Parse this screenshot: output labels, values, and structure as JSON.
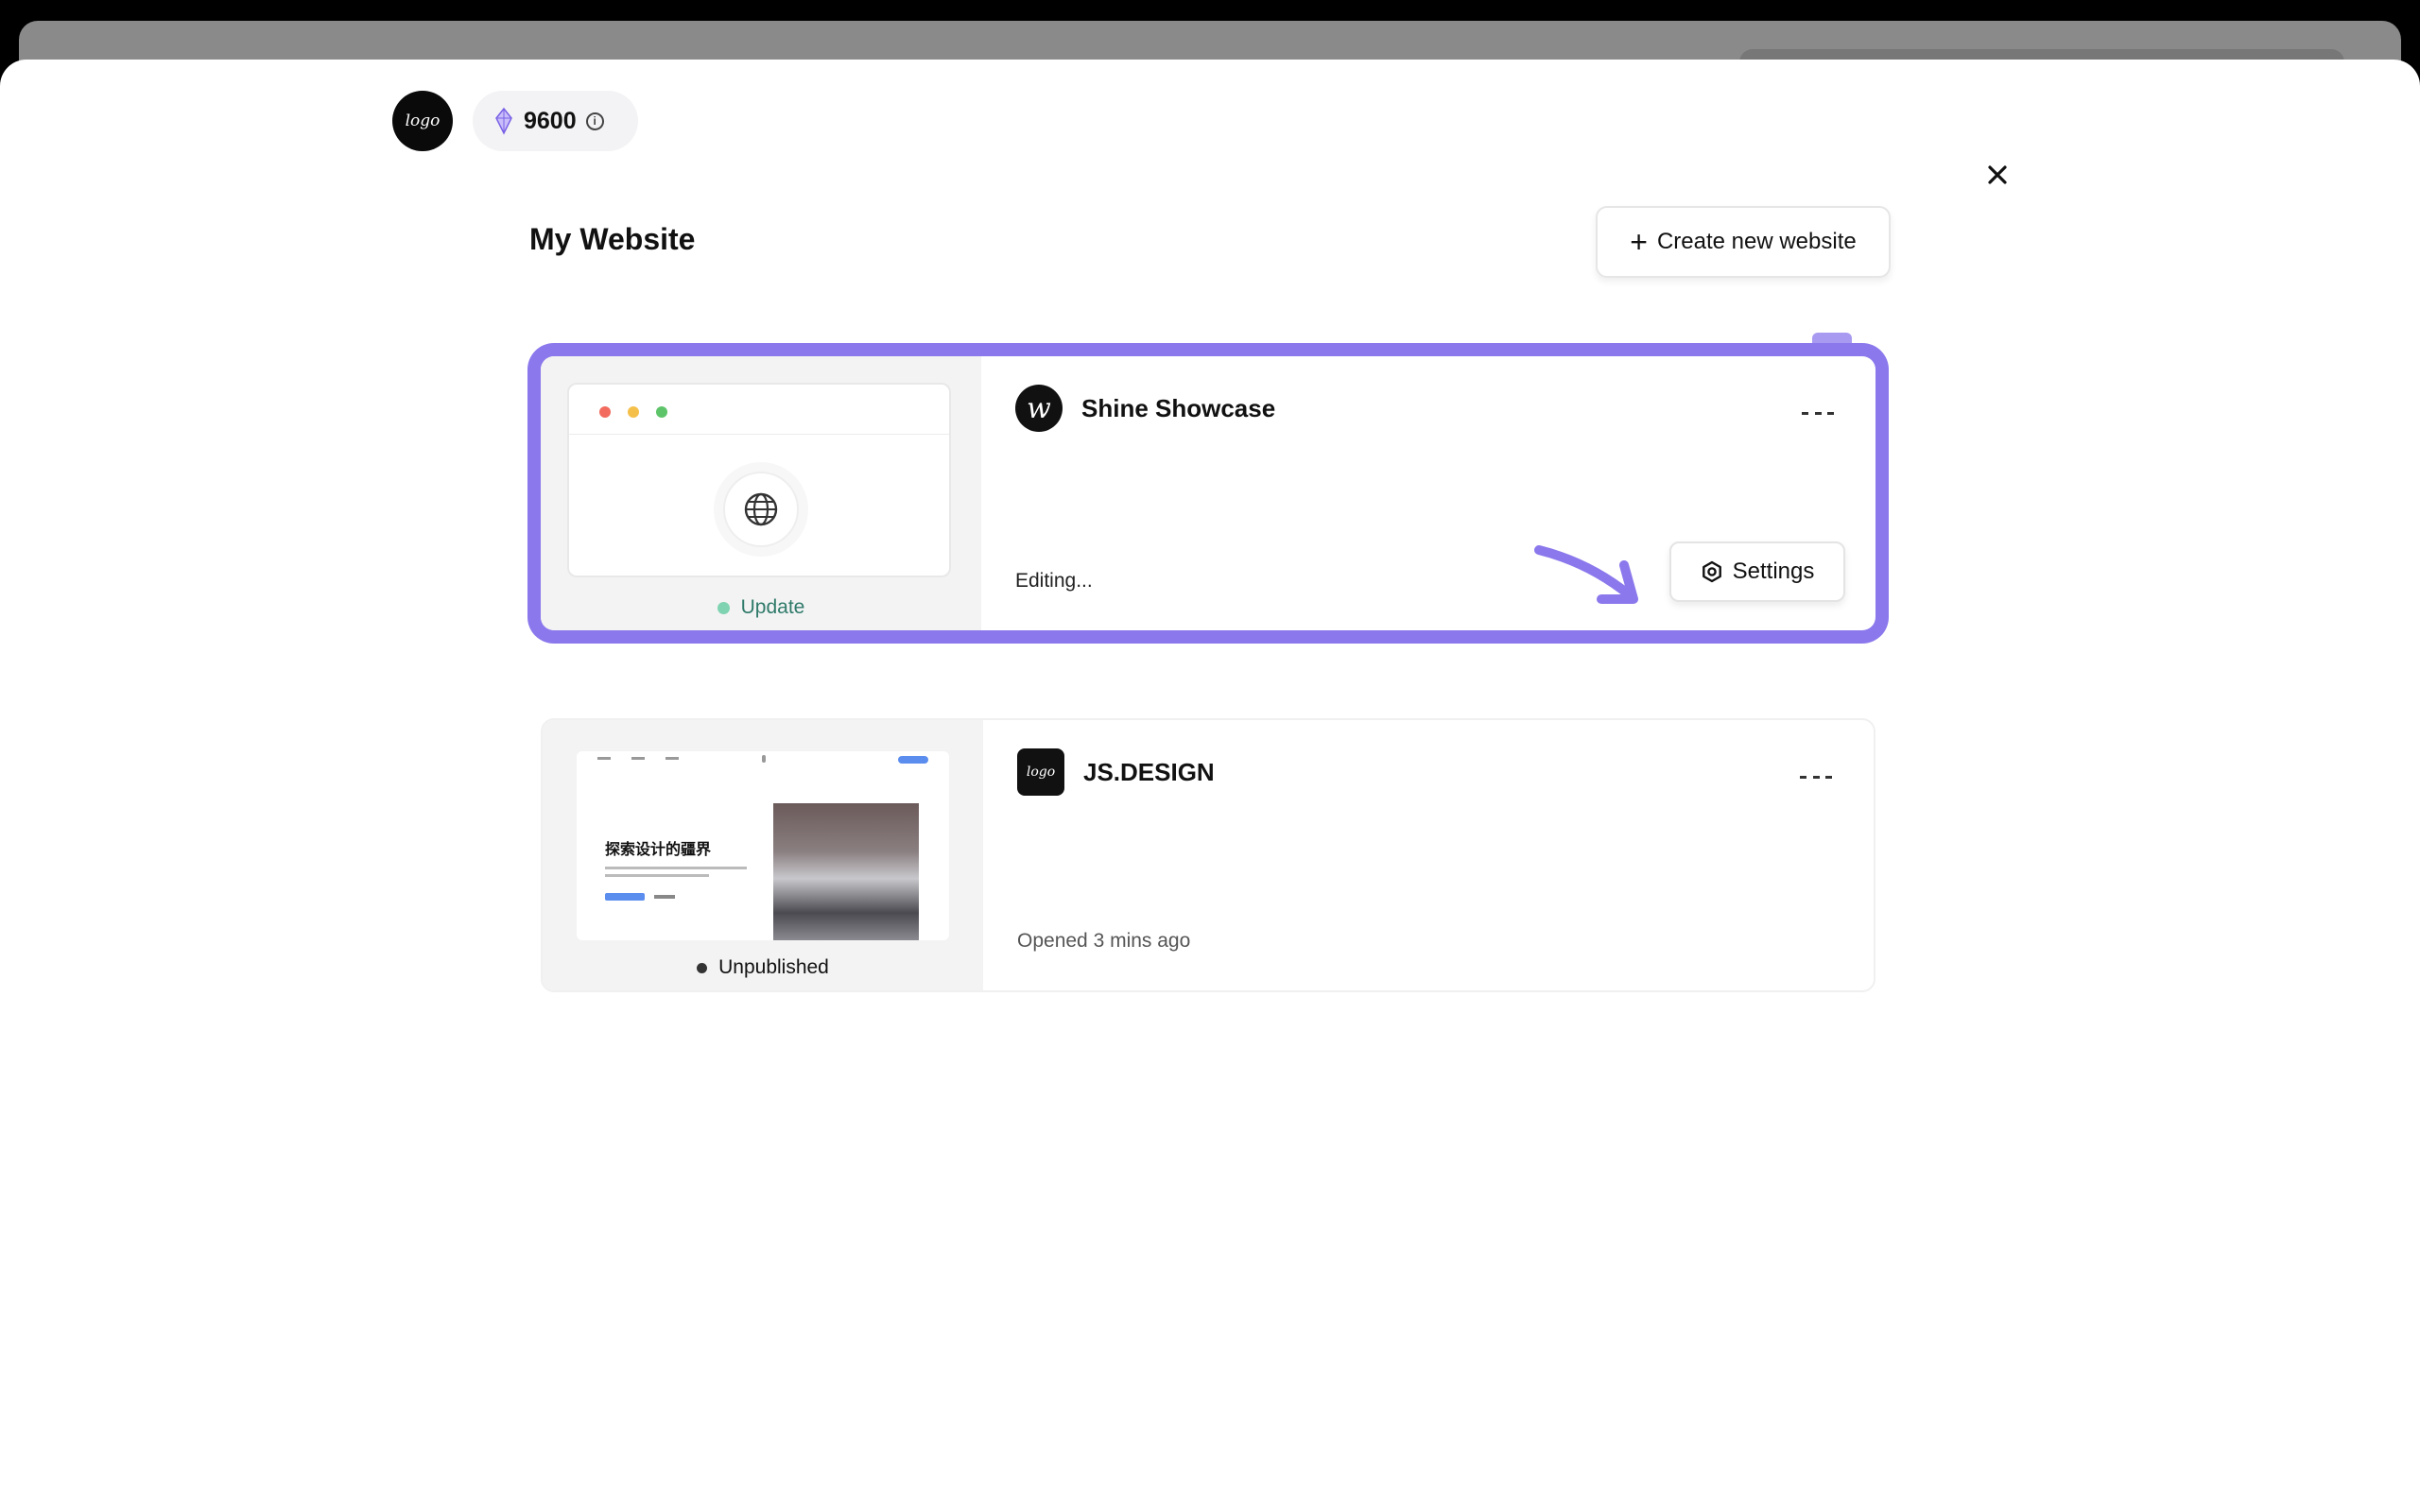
{
  "brand": {
    "logo_text": "logo"
  },
  "credits": {
    "value": "9600",
    "info_symbol": "i",
    "icon": "gem-icon"
  },
  "header": {
    "title": "My Website",
    "create_button_label": "Create new website",
    "create_button_icon": "plus-icon"
  },
  "close_icon": "close-icon",
  "colors": {
    "accent": "#8b78ec",
    "status_update": "#7fd3b0",
    "status_unpublished": "#333333"
  },
  "websites": [
    {
      "name": "Shine Showcase",
      "icon_text": "w",
      "status": "Update",
      "meta": "Editing...",
      "settings_label": "Settings",
      "selected": true
    },
    {
      "name": "JS.DESIGN",
      "icon_text": "logo",
      "status": "Unpublished",
      "meta": "Opened 3 mins ago",
      "preview_headline": "探索设计的疆界",
      "selected": false
    }
  ]
}
